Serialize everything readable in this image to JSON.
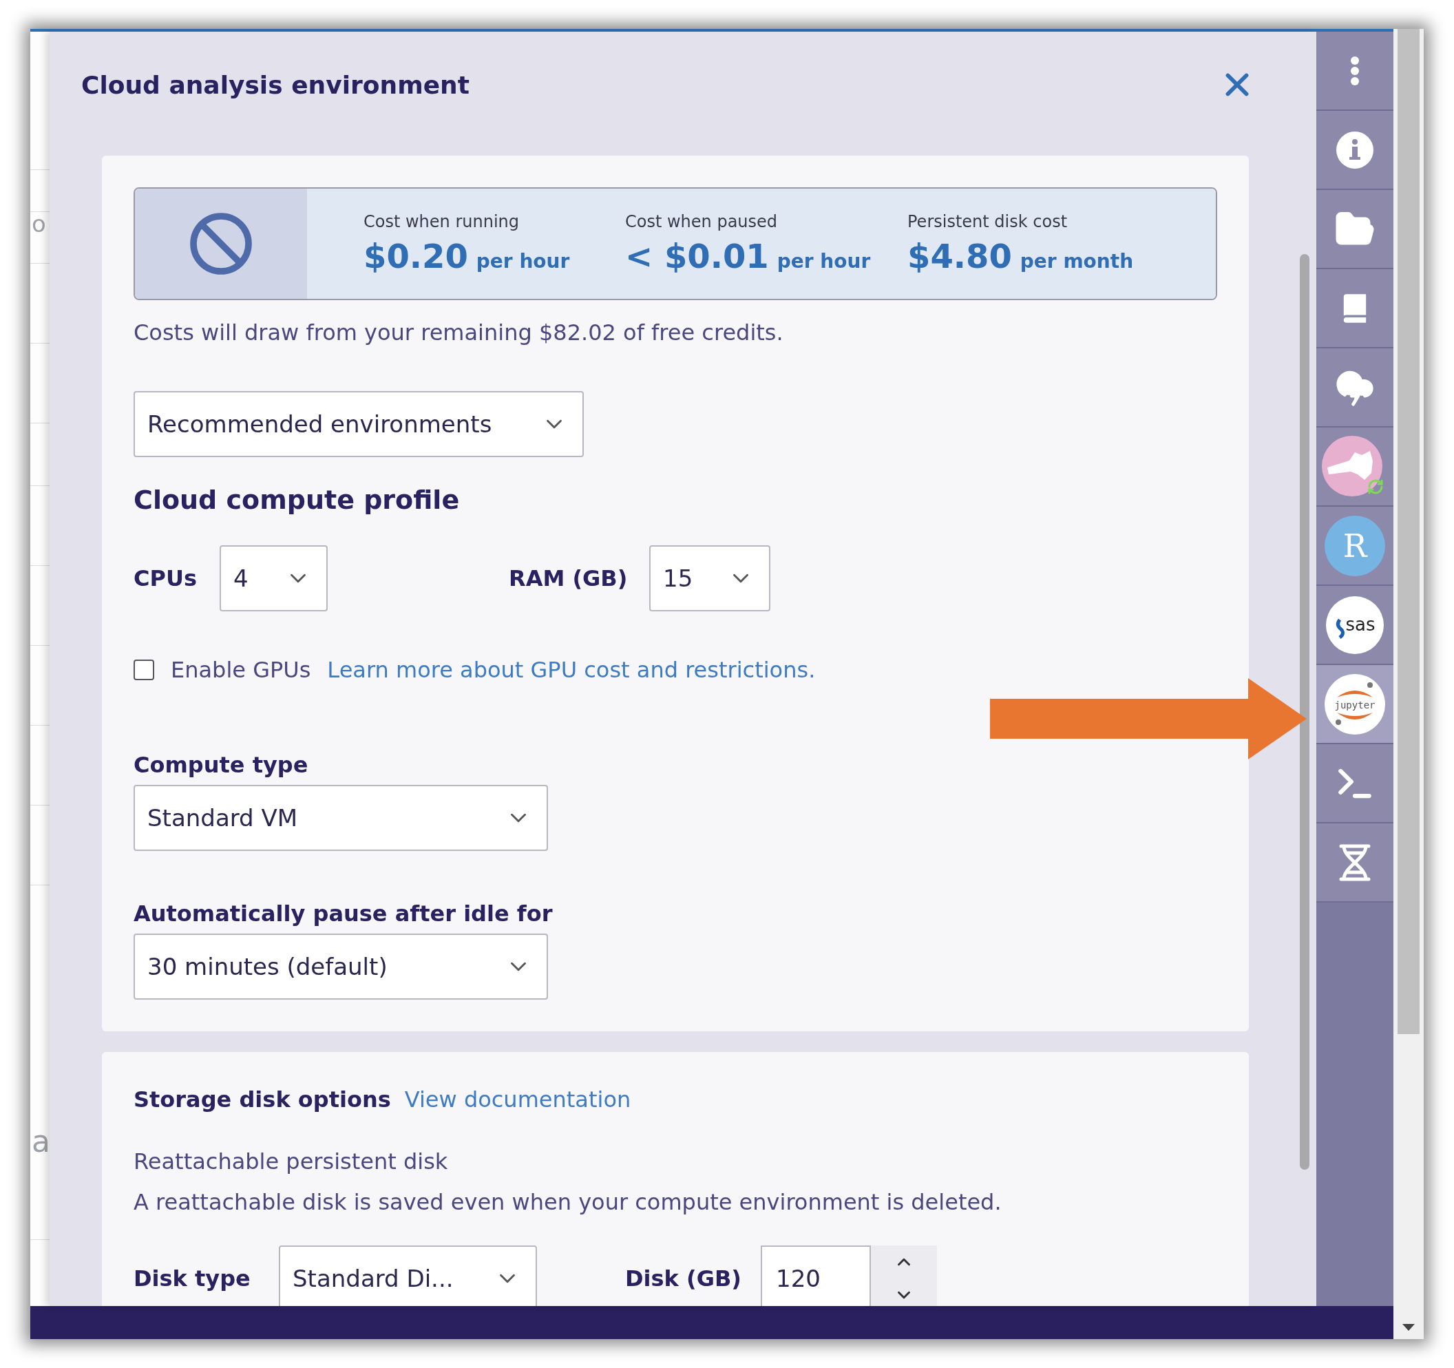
{
  "window": {
    "title": "Cloud analysis environment"
  },
  "background": {
    "fragments": [
      "o",
      "a"
    ]
  },
  "costs": [
    {
      "label": "Cost when running",
      "amount": "$0.20",
      "unit": "per hour"
    },
    {
      "label": "Cost when paused",
      "amount": "< $0.01",
      "unit": "per hour"
    },
    {
      "label": "Persistent disk cost",
      "amount": "$4.80",
      "unit": "per month"
    }
  ],
  "credits_note": "Costs will draw from your remaining $82.02 of free credits.",
  "environment_select": {
    "value": "Recommended environments"
  },
  "compute_profile": {
    "heading": "Cloud compute profile",
    "cpus": {
      "label": "CPUs",
      "value": "4"
    },
    "ram": {
      "label": "RAM (GB)",
      "value": "15"
    }
  },
  "gpu": {
    "label": "Enable GPUs",
    "checked": false,
    "link": "Learn more about GPU cost and restrictions."
  },
  "compute_type": {
    "label": "Compute type",
    "value": "Standard VM"
  },
  "auto_pause": {
    "label": "Automatically pause after idle for",
    "value": "30 minutes (default)"
  },
  "storage": {
    "heading": "Storage disk options",
    "link": "View documentation",
    "subheading": "Reattachable persistent disk",
    "description": "A reattachable disk is saved even when your compute environment is deleted.",
    "disk_type": {
      "label": "Disk type",
      "value": "Standard Di..."
    },
    "disk_size": {
      "label": "Disk (GB)",
      "value": "120"
    }
  },
  "sidebar": {
    "items": [
      {
        "kind": "menu",
        "selected": false
      },
      {
        "kind": "info",
        "selected": false
      },
      {
        "kind": "folder",
        "selected": false
      },
      {
        "kind": "book",
        "selected": false
      },
      {
        "kind": "cloud",
        "selected": false
      },
      {
        "kind": "animal",
        "selected": false
      },
      {
        "kind": "r",
        "label": "R",
        "selected": false
      },
      {
        "kind": "sas",
        "label": "sas",
        "selected": false
      },
      {
        "kind": "jupyter",
        "label": "jupyter",
        "selected": true
      },
      {
        "kind": "terminal",
        "selected": false
      },
      {
        "kind": "dna",
        "selected": false
      }
    ]
  }
}
